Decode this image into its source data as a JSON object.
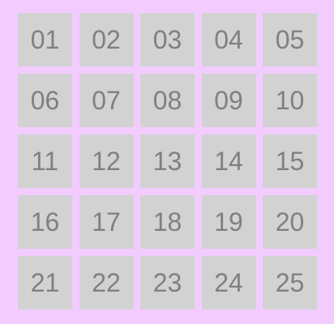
{
  "theme": {
    "background_color": "#f3ccff",
    "tile_color": "#d2d2d2",
    "text_color": "#808080"
  },
  "tiles": [
    {
      "label": "01"
    },
    {
      "label": "02"
    },
    {
      "label": "03"
    },
    {
      "label": "04"
    },
    {
      "label": "05"
    },
    {
      "label": "06"
    },
    {
      "label": "07"
    },
    {
      "label": "08"
    },
    {
      "label": "09"
    },
    {
      "label": "10"
    },
    {
      "label": "11"
    },
    {
      "label": "12"
    },
    {
      "label": "13"
    },
    {
      "label": "14"
    },
    {
      "label": "15"
    },
    {
      "label": "16"
    },
    {
      "label": "17"
    },
    {
      "label": "18"
    },
    {
      "label": "19"
    },
    {
      "label": "20"
    },
    {
      "label": "21"
    },
    {
      "label": "22"
    },
    {
      "label": "23"
    },
    {
      "label": "24"
    },
    {
      "label": "25"
    }
  ]
}
